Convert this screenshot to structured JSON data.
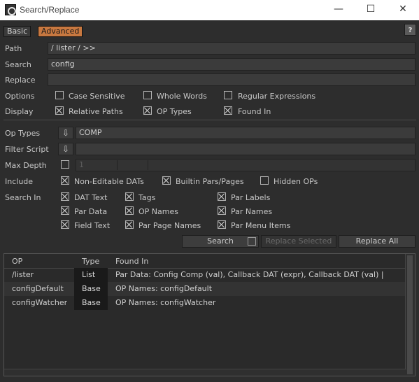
{
  "window": {
    "title": "Search/Replace",
    "minimize": "—",
    "maximize": "☐",
    "close": "✕"
  },
  "tabs": {
    "basic": "Basic",
    "advanced": "Advanced",
    "help": "?"
  },
  "fields": {
    "path": {
      "label": "Path",
      "value": "/ lister / >>"
    },
    "search": {
      "label": "Search",
      "value": "config"
    },
    "replace": {
      "label": "Replace",
      "value": ""
    }
  },
  "options": {
    "label": "Options",
    "case_sensitive": {
      "label": "Case Sensitive",
      "checked": false
    },
    "whole_words": {
      "label": "Whole Words",
      "checked": false
    },
    "regex": {
      "label": "Regular Expressions",
      "checked": false
    }
  },
  "display": {
    "label": "Display",
    "relative_paths": {
      "label": "Relative Paths",
      "checked": true
    },
    "op_types": {
      "label": "OP Types",
      "checked": true
    },
    "found_in": {
      "label": "Found In",
      "checked": true
    }
  },
  "op_types": {
    "label": "Op Types",
    "value": "COMP",
    "arrow": "⇩"
  },
  "filter_script": {
    "label": "Filter Script",
    "value": "",
    "arrow": "⇩"
  },
  "max_depth": {
    "label": "Max Depth",
    "value": "1",
    "checked": false
  },
  "include": {
    "label": "Include",
    "non_editable_dats": {
      "label": "Non-Editable DATs",
      "checked": true
    },
    "builtin_pars": {
      "label": "Builtin Pars/Pages",
      "checked": true
    },
    "hidden_ops": {
      "label": "Hidden OPs",
      "checked": false
    }
  },
  "search_in": {
    "label": "Search In",
    "dat_text": {
      "label": "DAT Text",
      "checked": true
    },
    "tags": {
      "label": "Tags",
      "checked": true
    },
    "par_labels": {
      "label": "Par Labels",
      "checked": true
    },
    "par_data": {
      "label": "Par Data",
      "checked": true
    },
    "op_names": {
      "label": "OP Names",
      "checked": true
    },
    "par_names": {
      "label": "Par Names",
      "checked": true
    },
    "field_text": {
      "label": "Field Text",
      "checked": true
    },
    "par_page_names": {
      "label": "Par Page Names",
      "checked": true
    },
    "par_menu_items": {
      "label": "Par Menu Items",
      "checked": true
    }
  },
  "buttons": {
    "search": "Search",
    "replace_selected": "Replace Selected",
    "replace_all": "Replace All"
  },
  "results": {
    "headers": {
      "op": "OP",
      "type": "Type",
      "found_in": "Found In"
    },
    "rows": [
      {
        "op": "/lister",
        "type": "List",
        "found_in": "Par Data: Config Comp (val), Callback DAT (expr), Callback DAT (val) |"
      },
      {
        "op": "configDefault",
        "type": "Base",
        "found_in": "OP Names: configDefault"
      },
      {
        "op": "configWatcher",
        "type": "Base",
        "found_in": "OP Names: configWatcher"
      }
    ]
  },
  "colors": {
    "accent": "#c87840",
    "background": "#2d2d2d",
    "field": "#3b3b3b"
  }
}
